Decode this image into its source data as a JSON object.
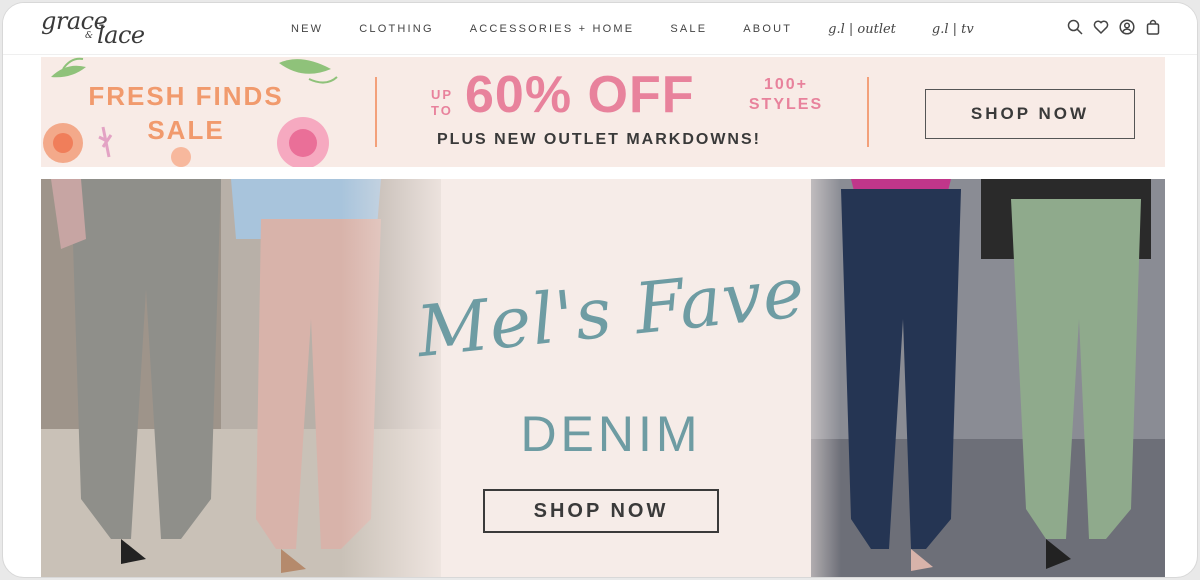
{
  "header": {
    "logo_line1": "grace",
    "logo_amp": "&",
    "logo_line2": "lace",
    "nav": [
      {
        "label": "NEW"
      },
      {
        "label": "CLOTHING"
      },
      {
        "label": "ACCESSORIES + HOME"
      },
      {
        "label": "SALE"
      },
      {
        "label": "ABOUT"
      },
      {
        "label": "g.l | outlet"
      },
      {
        "label": "g.l | tv"
      }
    ],
    "icons": [
      "search-icon",
      "heart-icon",
      "account-icon",
      "bag-icon"
    ]
  },
  "promo": {
    "headline": "FRESH FINDS SALE",
    "up_to": "UP TO",
    "percent": "60% OFF",
    "styles": "100+ STYLES",
    "subline": "PLUS NEW OUTLET MARKDOWNS!",
    "button": "SHOP NOW",
    "colors": {
      "bg": "#f8ebe6",
      "orange": "#f19a6d",
      "pink": "#e8829c"
    }
  },
  "hero": {
    "script_title": "Mel's Fave",
    "subtitle": "DENIM",
    "button": "SHOP NOW",
    "colors": {
      "bg": "#f6ece8",
      "teal": "#6e9ca3"
    }
  }
}
